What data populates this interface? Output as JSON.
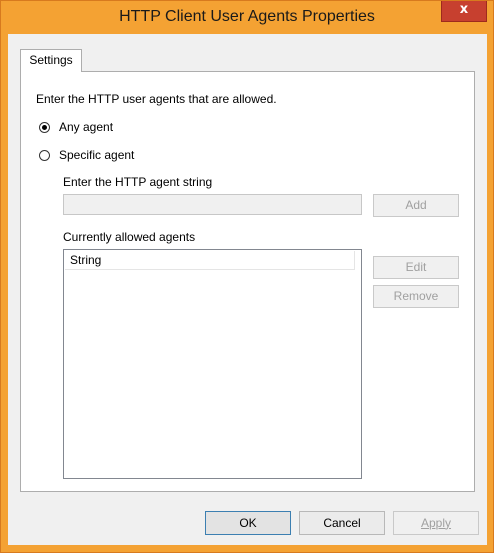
{
  "window": {
    "title": "HTTP Client User Agents Properties",
    "close_glyph": "x"
  },
  "tabs": [
    {
      "label": "Settings"
    }
  ],
  "settings": {
    "instruction": "Enter the HTTP user agents that are allowed.",
    "radio_any": {
      "label": "Any agent",
      "checked": true
    },
    "radio_specific": {
      "label": "Specific agent",
      "checked": false
    },
    "agent_string_label": "Enter the HTTP agent string",
    "agent_string_value": "",
    "add_label": "Add",
    "allowed_label": "Currently allowed agents",
    "list_column": "String",
    "edit_label": "Edit",
    "remove_label": "Remove"
  },
  "footer": {
    "ok_label": "OK",
    "cancel_label": "Cancel",
    "apply_label": "Apply"
  },
  "colors": {
    "titlebar": "#f4a233",
    "close_button": "#c7402f",
    "dialog_background": "#f0f0f0"
  }
}
